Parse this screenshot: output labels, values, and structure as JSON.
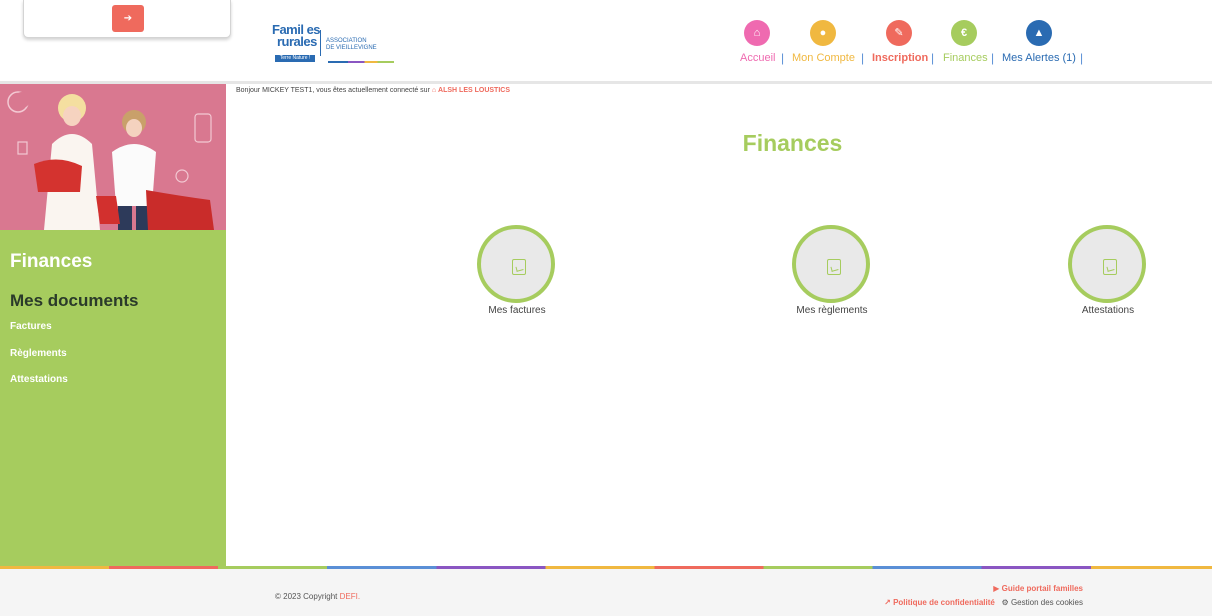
{
  "header": {
    "logout_icon": "sign-out-icon",
    "logo": {
      "text_line1": "Famil es",
      "text_line2": "rurales",
      "badge": "Terre Nature !",
      "association_line1": "ASSOCIATION",
      "association_line2": "DE VIEILLEVIGNE"
    },
    "nav": [
      {
        "label": "Accueil",
        "icon": "home-icon",
        "color": "#ef6ab0"
      },
      {
        "label": "Mon Compte",
        "icon": "user-icon",
        "color": "#f0b840"
      },
      {
        "label": "Inscription",
        "icon": "pencil-icon",
        "color": "#ef6a5d"
      },
      {
        "label": "Finances",
        "icon": "euro-icon",
        "color": "#a6cc5e"
      },
      {
        "label": "Mes Alertes (1)",
        "icon": "warning-icon",
        "color": "#2a6bb2"
      }
    ],
    "nav_separator": "|"
  },
  "greeting": {
    "prefix": "Bonjour MICKEY TEST1, vous êtes actuellement connecté sur",
    "center_icon": "home-icon",
    "center": "ALSH LES LOUSTICS"
  },
  "sidebar": {
    "title": "Finances",
    "subtitle": "Mes documents",
    "links": [
      "Factures",
      "Règlements",
      "Attestations"
    ]
  },
  "main": {
    "title": "Finances",
    "cards": [
      {
        "label": "Mes factures",
        "icon": "pdf-file-icon"
      },
      {
        "label": "Mes règlements",
        "icon": "pdf-file-icon"
      },
      {
        "label": "Attestations",
        "icon": "pdf-file-icon"
      }
    ]
  },
  "footer": {
    "copyright_prefix": "© 2023 Copyright",
    "copyright_brand": "DEFI.",
    "guide": "Guide portail familles",
    "guide_icon": "play-icon",
    "privacy": "Politique de confidentialité",
    "privacy_icon": "external-link-icon",
    "cookies": "Gestion des cookies",
    "cookies_icon": "gears-icon"
  }
}
